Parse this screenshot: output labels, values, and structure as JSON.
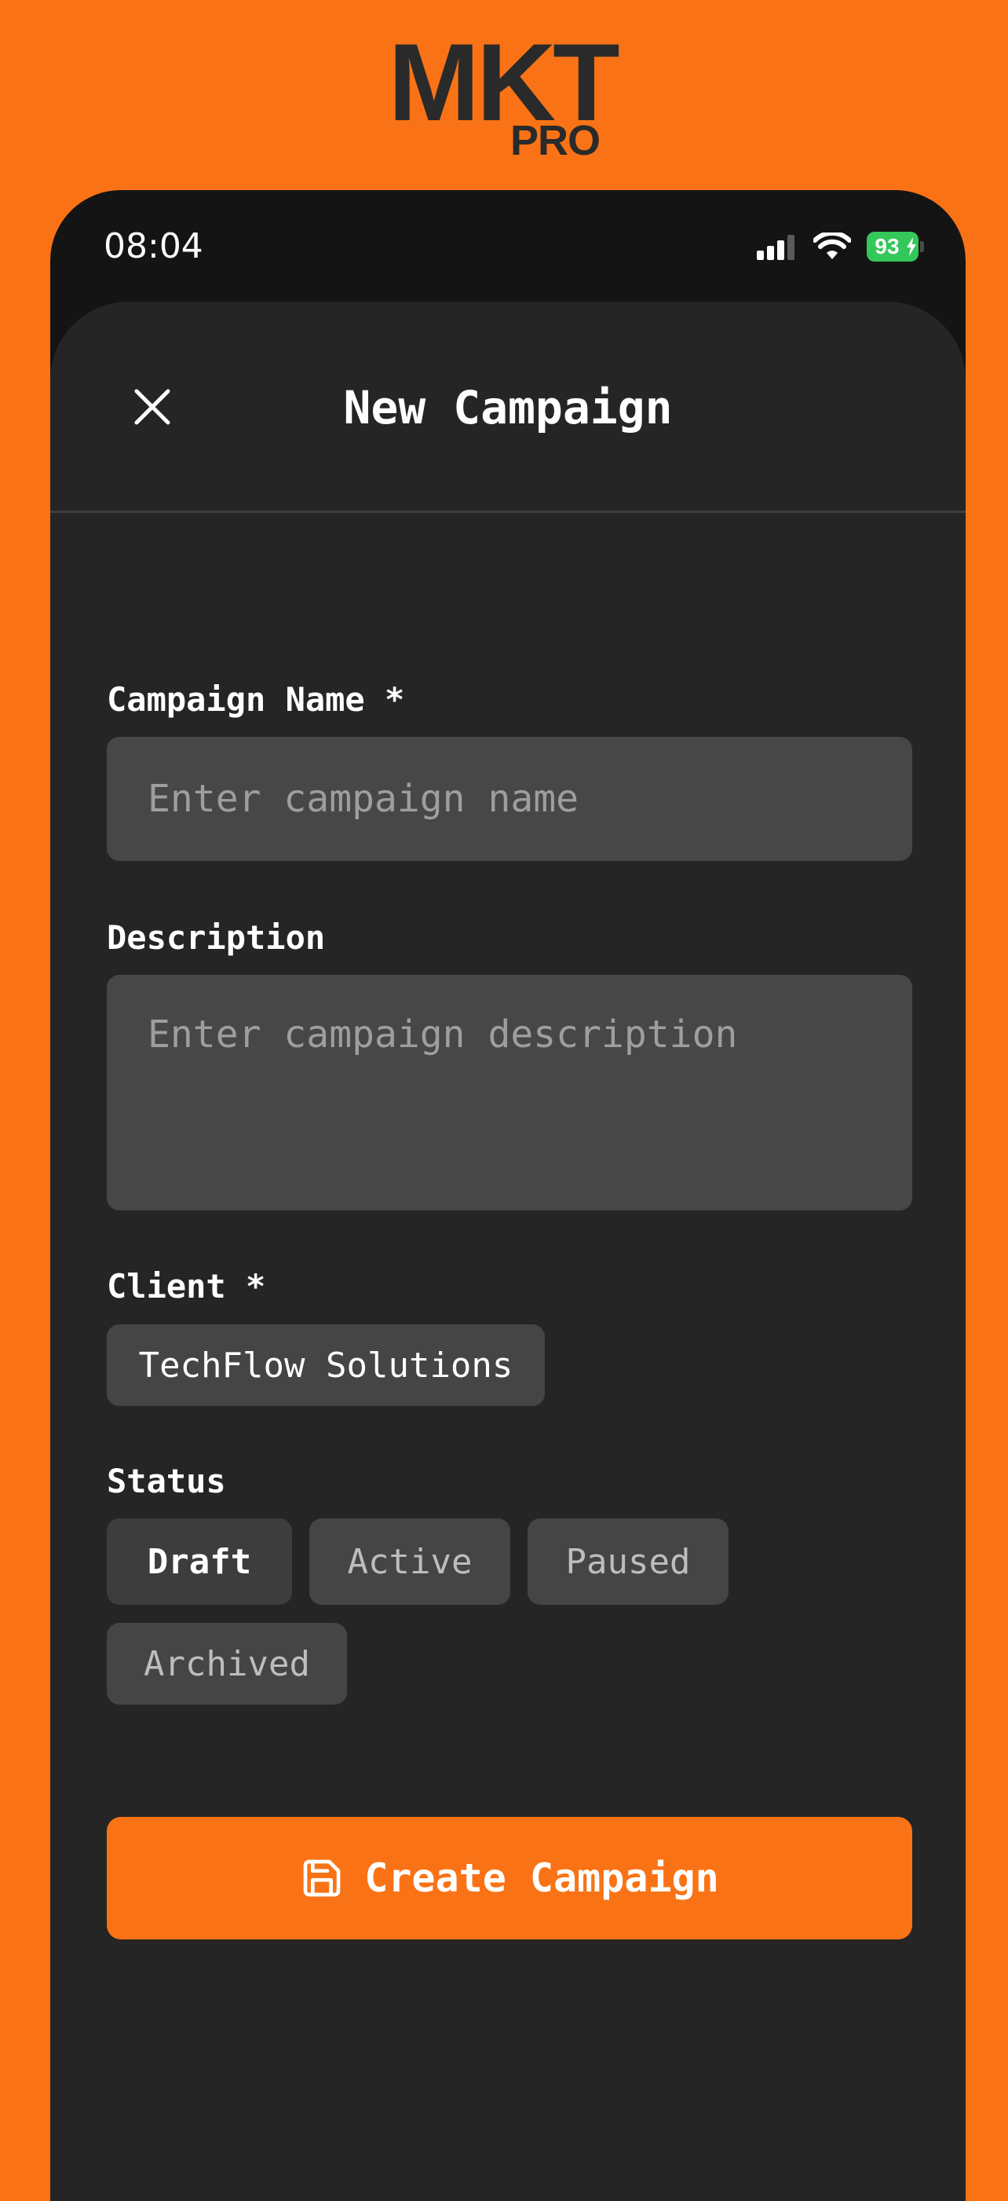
{
  "logo": {
    "main": "MKT",
    "sub": "PRO"
  },
  "status_bar": {
    "time": "08:04",
    "battery": "93"
  },
  "header": {
    "title": "New Campaign"
  },
  "form": {
    "name_label": "Campaign Name *",
    "name_placeholder": "Enter campaign name",
    "description_label": "Description",
    "description_placeholder": "Enter campaign description",
    "client_label": "Client *",
    "client_value": "TechFlow Solutions",
    "status_label": "Status",
    "status_options": [
      "Draft",
      "Active",
      "Paused",
      "Archived"
    ],
    "status_selected": "Draft"
  },
  "actions": {
    "create_label": "Create Campaign"
  },
  "colors": {
    "accent": "#F97316",
    "sheet": "#252525",
    "input": "#474747",
    "battery": "#34C759"
  }
}
